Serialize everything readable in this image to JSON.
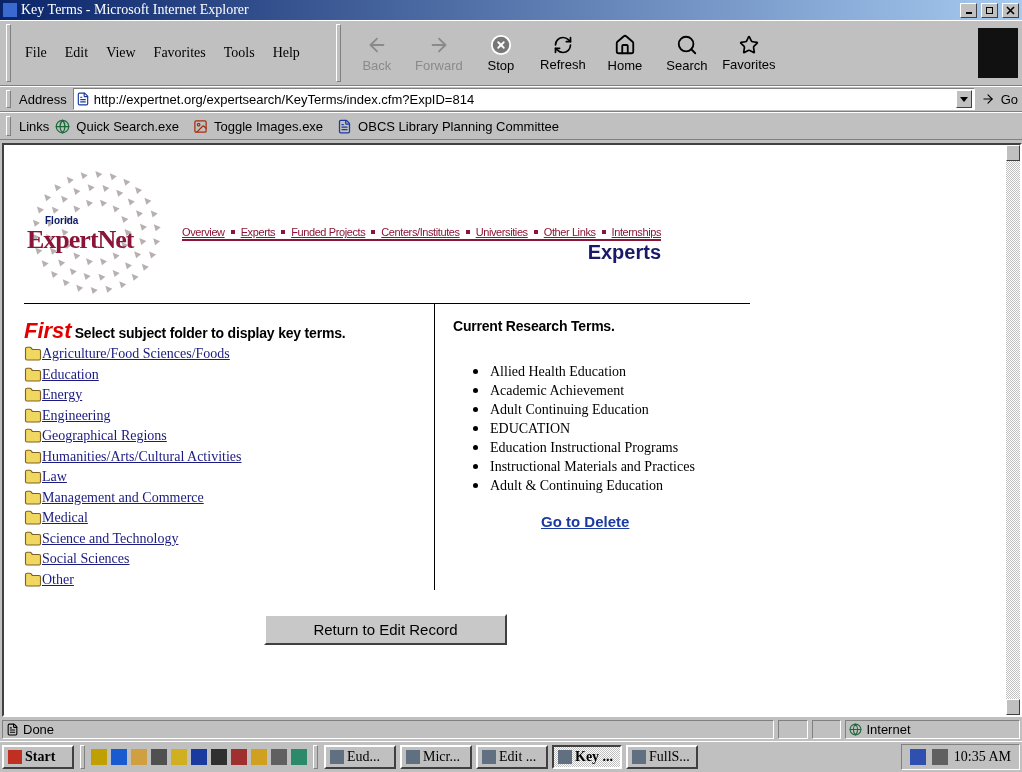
{
  "window": {
    "title": "Key Terms - Microsoft Internet Explorer"
  },
  "menu": [
    "File",
    "Edit",
    "View",
    "Favorites",
    "Tools",
    "Help"
  ],
  "toolbar": [
    {
      "label": "Back",
      "kind": "back",
      "disabled": true
    },
    {
      "label": "Forward",
      "kind": "forward",
      "disabled": true
    },
    {
      "label": "Stop",
      "kind": "stop",
      "disabled": false
    },
    {
      "label": "Refresh",
      "kind": "refresh",
      "disabled": false
    },
    {
      "label": "Home",
      "kind": "home",
      "disabled": false
    },
    {
      "label": "Search",
      "kind": "search",
      "disabled": false
    },
    {
      "label": "Favorites",
      "kind": "favorites",
      "disabled": false
    }
  ],
  "address": {
    "label": "Address",
    "value": "http://expertnet.org/expertsearch/KeyTerms/index.cfm?ExpID=814",
    "go": "Go"
  },
  "links_bar": {
    "label": "Links",
    "items": [
      {
        "label": "Quick Search.exe",
        "kind": "globe"
      },
      {
        "label": "Toggle Images.exe",
        "kind": "image"
      },
      {
        "label": "OBCS Library Planning Committee",
        "kind": "page"
      }
    ]
  },
  "page": {
    "logo": {
      "small": "Florida",
      "name": "ExpertNet"
    },
    "nav": [
      "Overview",
      "Experts",
      "Funded Projects",
      "Centers/Institutes",
      "Universities",
      "Other Links",
      "Internships"
    ],
    "section_title": "Experts",
    "left": {
      "lead": "First",
      "heading": "Select subject folder to display key terms.",
      "folders": [
        "Agriculture/Food Sciences/Foods",
        "Education",
        "Energy",
        "Engineering",
        "Geographical Regions",
        "Humanities/Arts/Cultural Activities",
        "Law",
        "Management and Commerce",
        "Medical",
        "Science and Technology",
        "Social Sciences",
        "Other"
      ]
    },
    "right": {
      "heading": "Current Research Terms.",
      "terms": [
        "Allied Health Education",
        "Academic Achievement",
        "Adult Continuing Education",
        "EDUCATION",
        "Education Instructional Programs",
        "Instructional Materials and Practices",
        "Adult & Continuing Education"
      ],
      "link": "Go to Delete"
    },
    "button": "Return to Edit Record"
  },
  "status_bar": {
    "text": "Done",
    "zone": "Internet"
  },
  "taskbar": {
    "start": "Start",
    "tasks": [
      {
        "label": "Eud...",
        "selected": false
      },
      {
        "label": "Micr...",
        "selected": false
      },
      {
        "label": "Edit ...",
        "selected": false
      },
      {
        "label": "Key ...",
        "selected": true
      },
      {
        "label": "FullS...",
        "selected": false
      }
    ],
    "time": "10:35 AM"
  }
}
